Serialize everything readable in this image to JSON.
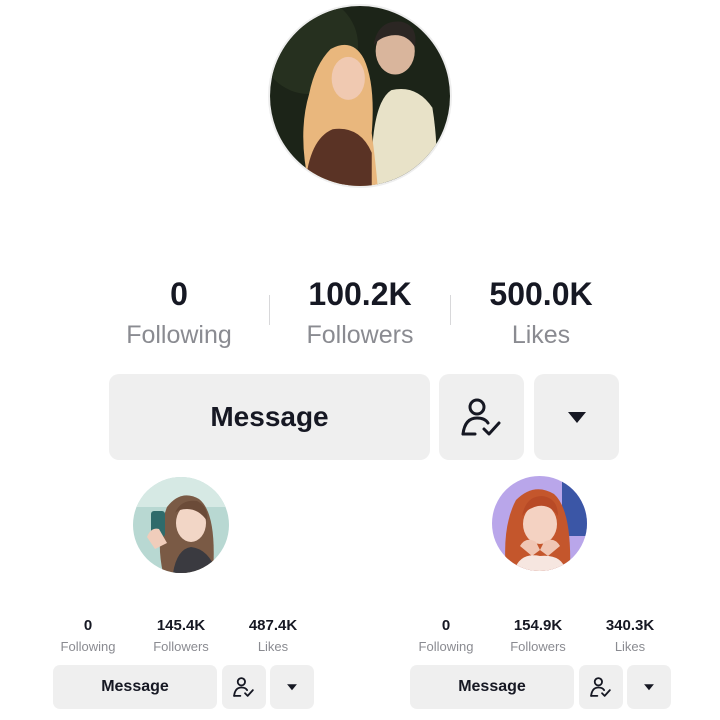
{
  "profiles": [
    {
      "stats": [
        {
          "value": "0",
          "label": "Following"
        },
        {
          "value": "100.2K",
          "label": "Followers"
        },
        {
          "value": "500.0K",
          "label": "Likes"
        }
      ],
      "message_label": "Message",
      "icons": {
        "friend": "person-check-icon",
        "more": "caret-down-icon"
      }
    },
    {
      "stats": [
        {
          "value": "0",
          "label": "Following"
        },
        {
          "value": "145.4K",
          "label": "Followers"
        },
        {
          "value": "487.4K",
          "label": "Likes"
        }
      ],
      "message_label": "Message",
      "icons": {
        "friend": "person-check-icon",
        "more": "caret-down-icon"
      }
    },
    {
      "stats": [
        {
          "value": "0",
          "label": "Following"
        },
        {
          "value": "154.9K",
          "label": "Followers"
        },
        {
          "value": "340.3K",
          "label": "Likes"
        }
      ],
      "message_label": "Message",
      "icons": {
        "friend": "person-check-icon",
        "more": "caret-down-icon"
      }
    }
  ],
  "colors": {
    "button_bg": "#efefef",
    "label_gray": "#8a8b91",
    "text": "#161823"
  }
}
